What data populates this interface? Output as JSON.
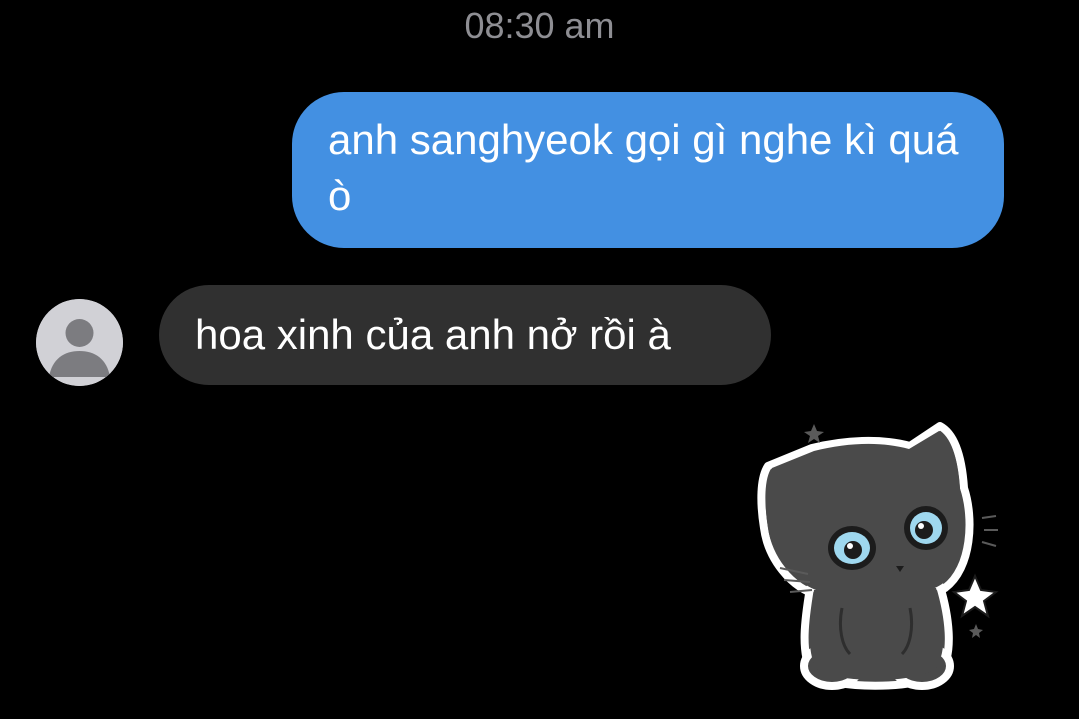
{
  "header": {
    "timestamp": "08:30 am"
  },
  "messages": [
    {
      "direction": "outgoing",
      "text": "anh sanghyeok gọi gì nghe kì quá ò"
    },
    {
      "direction": "incoming",
      "text": "hoa xinh của anh nở rồi à"
    }
  ],
  "sticker": {
    "icon": "black-cat-sticker"
  },
  "colors": {
    "background": "#000000",
    "outgoing_bubble": "#4390e2",
    "incoming_bubble": "#303030",
    "timestamp_text": "#8e8e93",
    "avatar_bg": "#d1d1d6"
  }
}
